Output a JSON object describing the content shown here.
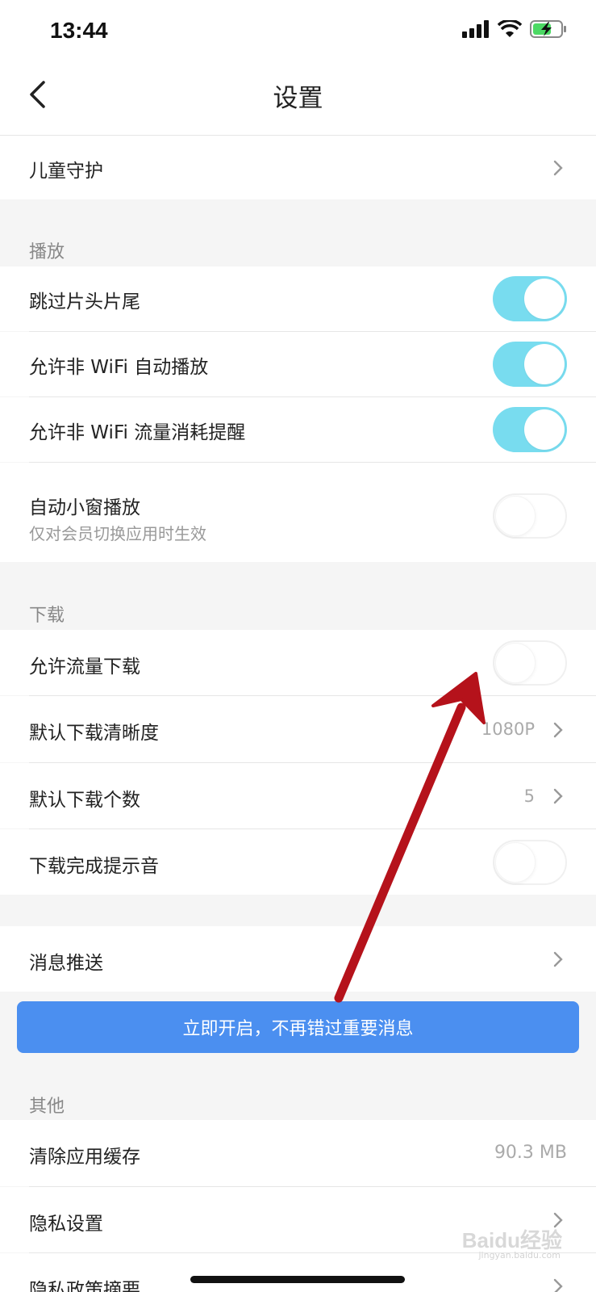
{
  "status_bar": {
    "time": "13:44"
  },
  "nav": {
    "title": "设置"
  },
  "top": {
    "children_protection": "儿童守护"
  },
  "playback": {
    "section_title": "播放",
    "skip_intro": "跳过片头片尾",
    "autoplay_non_wifi": "允许非 WiFi 自动播放",
    "non_wifi_reminder": "允许非 WiFi 流量消耗提醒",
    "mini_window": "自动小窗播放",
    "mini_window_sub": "仅对会员切换应用时生效"
  },
  "download": {
    "section_title": "下载",
    "allow_cellular": "允许流量下载",
    "default_quality": "默认下载清晰度",
    "default_quality_value": "1080P",
    "default_count": "默认下载个数",
    "default_count_value": "5",
    "complete_sound": "下载完成提示音"
  },
  "notifications": {
    "push": "消息推送",
    "banner": "立即开启，不再错过重要消息"
  },
  "other": {
    "section_title": "其他",
    "clear_cache": "清除应用缓存",
    "cache_size": "90.3 MB",
    "privacy_settings": "隐私设置",
    "privacy_summary": "隐私政策摘要"
  },
  "toggles": {
    "skip_intro": true,
    "autoplay_non_wifi": true,
    "non_wifi_reminder": true,
    "mini_window": false,
    "allow_cellular": false,
    "complete_sound": false
  },
  "watermark": {
    "brand": "Baidu经验",
    "url": "jingyan.baidu.com"
  },
  "colors": {
    "toggle_on": "#78dcef",
    "banner": "#4b8ff0",
    "annotation_arrow": "#b5121b"
  },
  "icons": [
    "signal-icon",
    "wifi-icon",
    "battery-charging-icon",
    "back-chevron-icon",
    "chevron-right-icon"
  ]
}
